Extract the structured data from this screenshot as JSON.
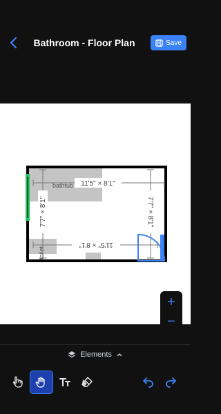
{
  "header": {
    "title": "Bathroom - Floor Plan",
    "save_label": "Save"
  },
  "plan": {
    "dim_top": "11'5\" × 8'1\"",
    "dim_bottom": "11'5\" × 8'1\"",
    "dim_left": "7'7\" × 8'1\"",
    "dim_right": "7'7\" × 8'1\"",
    "label_bathtub": "bathtub",
    "label_toilet": "toilet"
  },
  "zoom": {
    "plus": "+",
    "minus": "−"
  },
  "bottom": {
    "elements_label": "Elements"
  },
  "tools": [
    "pointer-tool",
    "hand-tool",
    "text-tool",
    "eraser-tool"
  ],
  "colors": {
    "accent": "#3b82f6",
    "wall": "#000000",
    "fixture": "#c4c4c4",
    "window": "#22c55e",
    "door": "#3b82f6"
  }
}
